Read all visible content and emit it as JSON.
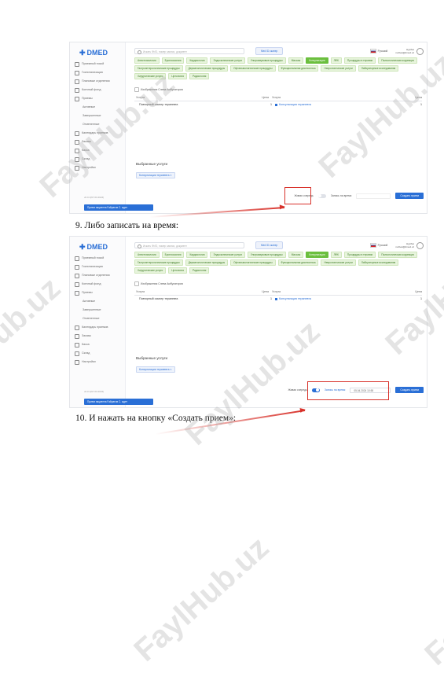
{
  "screenshot1": {
    "logo": "DMED",
    "nav": [
      "Приемный покой",
      "Госпитализация",
      "Плановые отделения",
      "Коечный фонд",
      "Приемы",
      "Активные",
      "Завершенные",
      "Отмененные",
      "Календарь приемов",
      "Заказы",
      "Касса",
      "Склад",
      "Настройки"
    ],
    "build": "v0.0.1(97.03.2024)",
    "toast": "Прием пациента Ғайратов С. ждет",
    "search_placeholder": "Искать ФИО, номер записи, документ",
    "mbtn": "Med ID сканер",
    "lang": "Русский",
    "user_name": "Нурбек",
    "user_email": "nurbek@dmed.uz",
    "tags": [
      "Анестезиология",
      "Бронхоскопия",
      "Кардиология",
      "Эндоскопические услуги",
      "Ультразвуковые процедуры",
      "Массаж",
      "Консультация",
      "ЛФК",
      "Процедуры в терапии",
      "Психологическая коррекция",
      "Гастроэнтерологические процедуры",
      "Дерматологические процедуры",
      "Офтальмологические процедуры",
      "Функциональная диагностика",
      "Неврологические услуги",
      "Лабораторные исследования",
      "Хирургические услуги",
      "Цитология",
      "Радиология"
    ],
    "active_tag": "Консультация",
    "checkbox_label": "Изображения Слева Амбулатория",
    "table_headers": [
      "Услуга",
      "Цена",
      "Услуга",
      "Цена"
    ],
    "row": {
      "service": "Повторный осмотр терапевта",
      "price": "1",
      "consult": "Консультация терапевта",
      "price2": "1"
    },
    "chosen_title": "Выбранные услуги",
    "chosen_tag": "Консультация терапевта ×",
    "live_queue": "Живая очередь",
    "record_time": "Запись на время",
    "create_btn": "Создать прием"
  },
  "step9": "9.   Либо записать на время:",
  "screenshot2": {
    "live_queue": "Живая очередь",
    "record_time": "Запись на время",
    "datetime": "05.04.2024 10:55",
    "create_btn": "Создать прием"
  },
  "step10": "10. И нажать на кнопку «Создать прием»:",
  "watermark": "FaylHub.uz"
}
